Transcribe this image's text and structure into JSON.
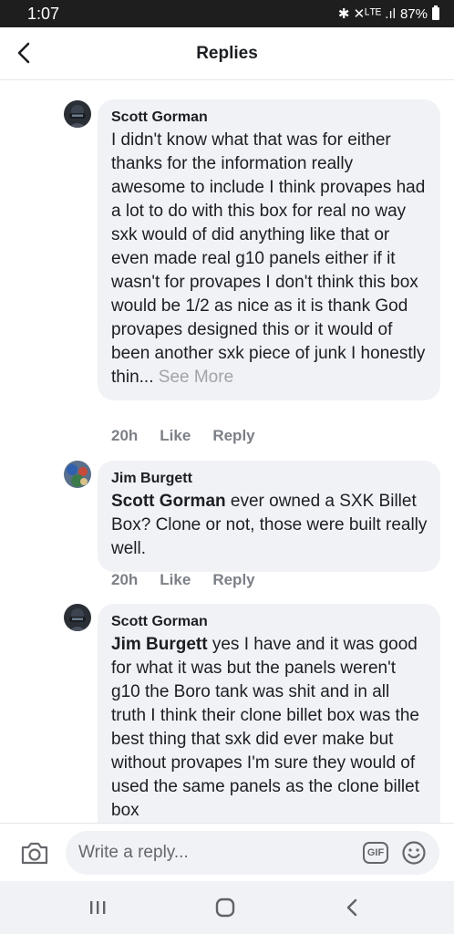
{
  "status_bar": {
    "time": "1:07",
    "indicators": "✱ ✕ᴸᵀᴱ .ıl",
    "battery": "87%"
  },
  "header": {
    "title": "Replies",
    "back_icon": "chevron-left-icon"
  },
  "comments": [
    {
      "author": "Scott Gorman",
      "mention": "",
      "text": "I didn't know what that was for either thanks for the information really awesome to include I think provapes had a lot to do with this box for real no way sxk would of did anything like that or even made real g10 panels either if it wasn't for provapes I don't think this box would be 1/2 as nice as it is thank God provapes designed this or it would of been another sxk piece of junk I honestly thin...",
      "see_more": "See More",
      "time": "20h",
      "like": "Like",
      "reply": "Reply"
    },
    {
      "author": "Jim Burgett",
      "mention": "Scott Gorman",
      "text": " ever owned a SXK Billet Box? Clone or not, those were built really well.",
      "time": "20h",
      "like": "Like",
      "reply": "Reply"
    },
    {
      "author": "Scott Gorman",
      "mention": "Jim Burgett",
      "text": " yes I have and it was good for what it was but the panels weren't g10 the Boro tank was shit and in all truth I think their clone billet box was the best thing that sxk did ever make but without provapes I'm sure they would of used the same panels as the clone billet box"
    }
  ],
  "composer": {
    "placeholder": "Write a reply...",
    "gif_label": "GIF"
  },
  "colors": {
    "status_bar": "#1e1e1e",
    "bubble": "#f0f2f5",
    "meta_text": "#7c8087",
    "see_more": "#a0a3a8"
  }
}
